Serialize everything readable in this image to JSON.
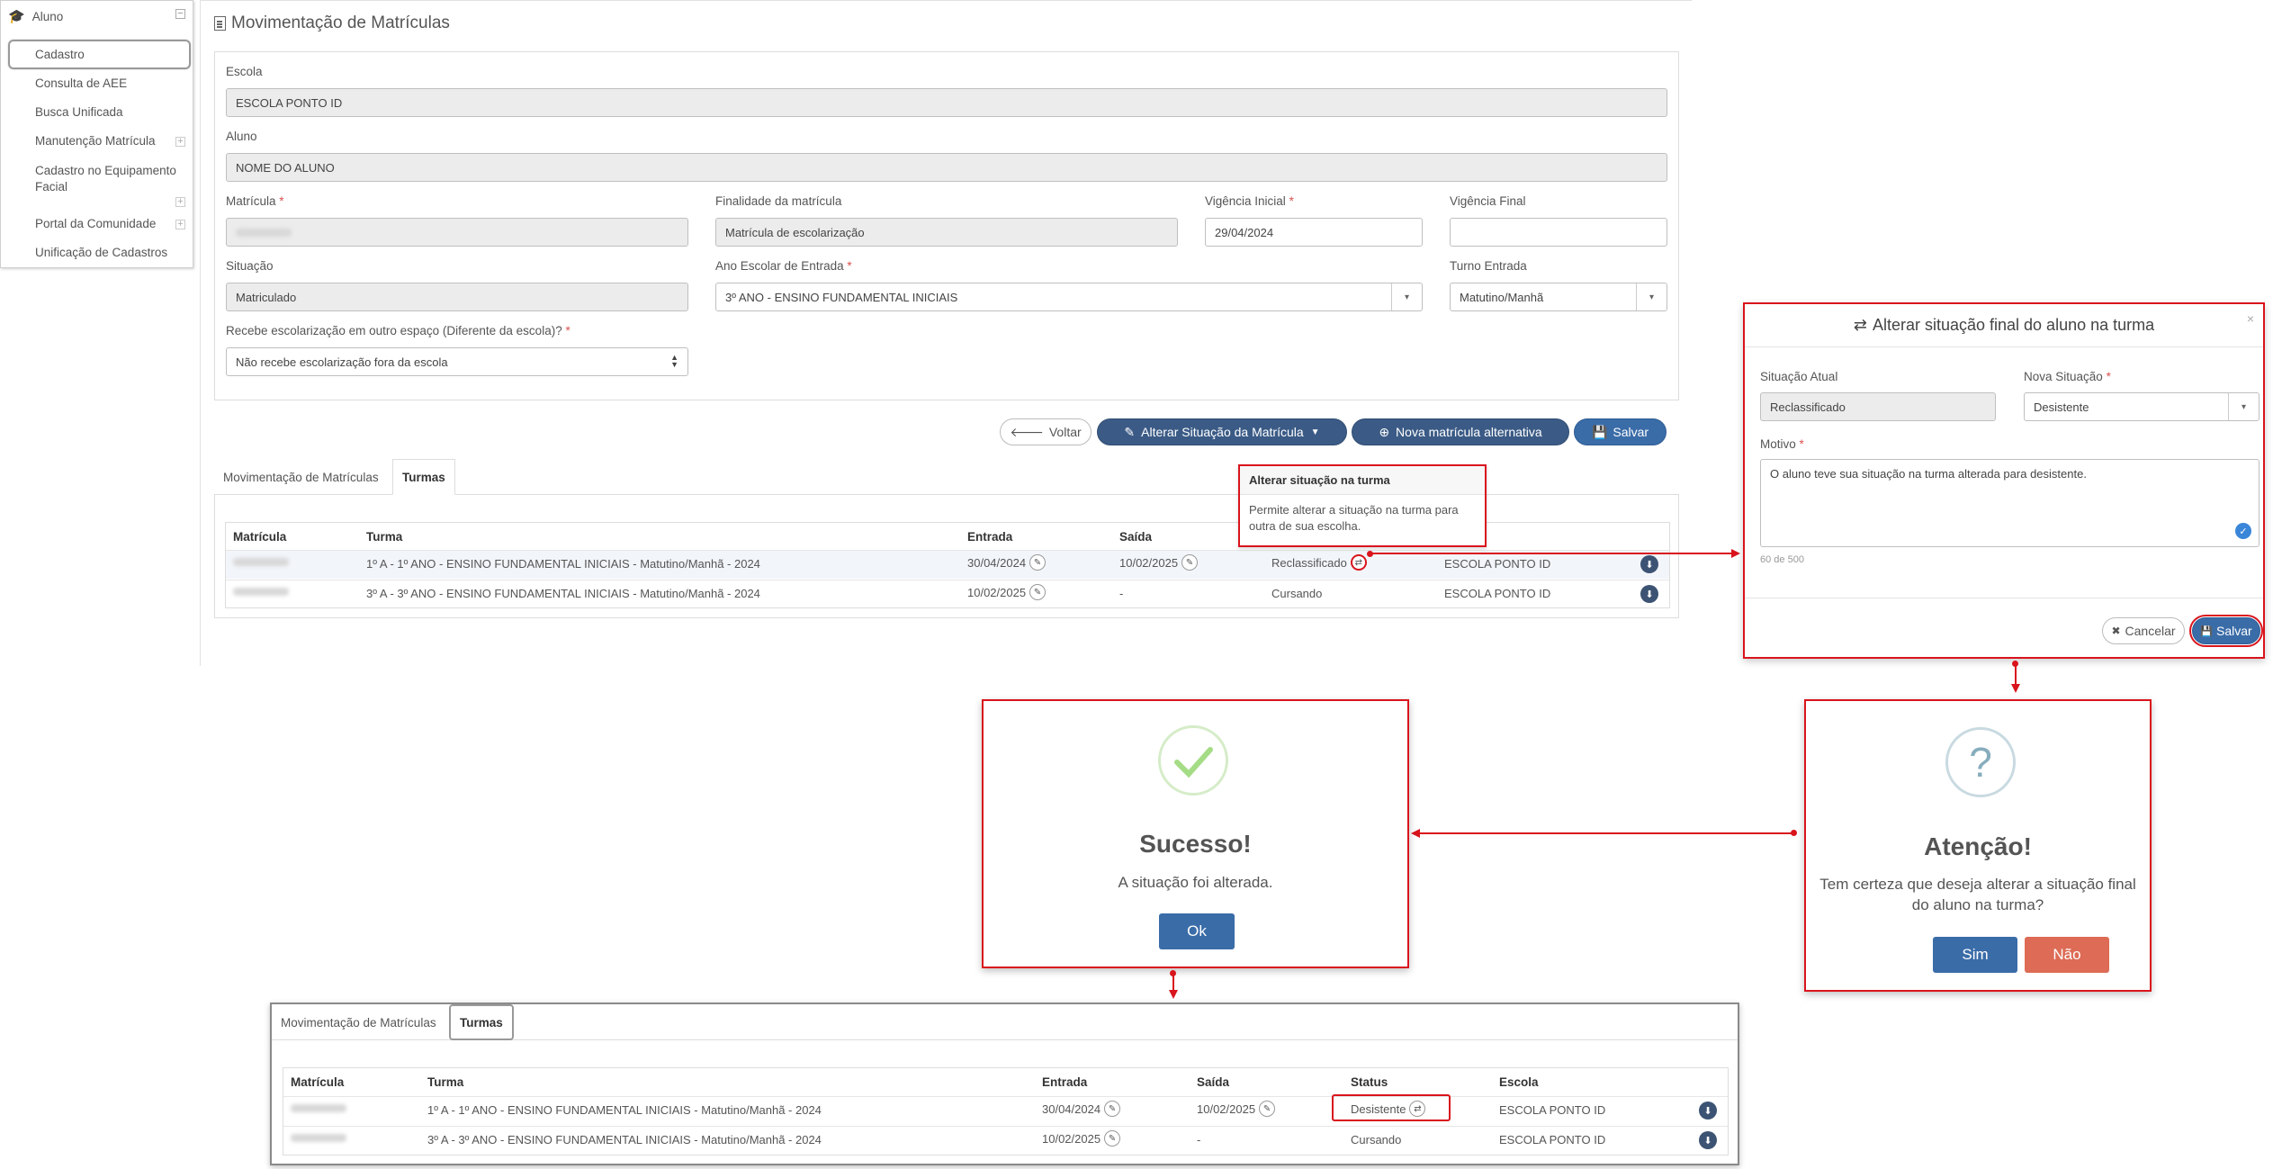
{
  "sidebar": {
    "title": "Aluno",
    "items": [
      "Cadastro",
      "Consulta de AEE",
      "Busca Unificada",
      "Manutenção Matrícula",
      "Cadastro no Equipamento Facial",
      "Portal da Comunidade",
      "Unificação de Cadastros"
    ]
  },
  "page_title": "Movimentação de Matrículas",
  "form": {
    "escola_label": "Escola",
    "escola_value": "ESCOLA PONTO ID",
    "aluno_label": "Aluno",
    "aluno_value": "NOME DO ALUNO",
    "matricula_label": "Matrícula",
    "finalidade_label": "Finalidade da matrícula",
    "finalidade_value": "Matrícula de escolarização",
    "vig_ini_label": "Vigência Inicial",
    "vig_ini_value": "29/04/2024",
    "vig_fim_label": "Vigência Final",
    "situacao_label": "Situação",
    "situacao_value": "Matriculado",
    "ano_label": "Ano Escolar de Entrada",
    "ano_value": "3º ANO - ENSINO FUNDAMENTAL INICIAIS",
    "turno_label": "Turno Entrada",
    "turno_value": "Matutino/Manhã",
    "recebe_label": "Recebe escolarização em outro espaço (Diferente da escola)?",
    "recebe_value": "Não recebe escolarização fora da escola",
    "required_mark": "*"
  },
  "buttons": {
    "voltar": "Voltar",
    "alterar": "Alterar Situação da Matrícula",
    "nova": "Nova matrícula alternativa",
    "salvar": "Salvar"
  },
  "tabs": [
    "Movimentação de Matrículas",
    "Turmas"
  ],
  "table": {
    "headers": [
      "Matrícula",
      "Turma",
      "Entrada",
      "Saída",
      "Status",
      "Escola"
    ],
    "rows": [
      {
        "turma": "1º A - 1º ANO - ENSINO FUNDAMENTAL INICIAIS - Matutino/Manhã - 2024",
        "entrada": "30/04/2024",
        "saida": "10/02/2025",
        "status": "Reclassificado",
        "escola": "ESCOLA PONTO ID"
      },
      {
        "turma": "3º A - 3º ANO - ENSINO FUNDAMENTAL INICIAIS - Matutino/Manhã - 2024",
        "entrada": "10/02/2025",
        "saida": "-",
        "status": "Cursando",
        "escola": "ESCOLA PONTO ID"
      }
    ]
  },
  "tooltip": {
    "title": "Alterar situação na turma",
    "body": "Permite alterar a situação na turma para outra de sua escolha."
  },
  "modal": {
    "title": "Alterar situação final do aluno na turma",
    "close": "×",
    "atual_label": "Situação Atual",
    "atual_value": "Reclassificado",
    "nova_label": "Nova Situação",
    "nova_value": "Desistente",
    "motivo_label": "Motivo",
    "motivo_value": "O aluno teve sua situação na turma alterada para desistente.",
    "counter": "60 de 500",
    "cancelar": "Cancelar",
    "salvar": "Salvar"
  },
  "success_dialog": {
    "title": "Sucesso!",
    "text": "A situação foi alterada.",
    "ok": "Ok"
  },
  "confirm_dialog": {
    "icon": "?",
    "title": "Atenção!",
    "text_line1": "Tem certeza que deseja alterar a situação final",
    "text_line2": "do aluno na turma?",
    "sim": "Sim",
    "nao": "Não"
  },
  "result_table": {
    "rows": [
      {
        "turma": "1º A - 1º ANO - ENSINO FUNDAMENTAL INICIAIS - Matutino/Manhã - 2024",
        "entrada": "30/04/2024",
        "saida": "10/02/2025",
        "status": "Desistente",
        "escola": "ESCOLA PONTO ID"
      },
      {
        "turma": "3º A - 3º ANO - ENSINO FUNDAMENTAL INICIAIS - Matutino/Manhã - 2024",
        "entrada": "10/02/2025",
        "saida": "-",
        "status": "Cursando",
        "escola": "ESCOLA PONTO ID"
      }
    ]
  },
  "colors": {
    "accent": "#3a6ca8",
    "dark_button": "#3b5b86",
    "highlight": "#d9141c",
    "success": "#a5dc86",
    "danger": "#dd6b55"
  }
}
